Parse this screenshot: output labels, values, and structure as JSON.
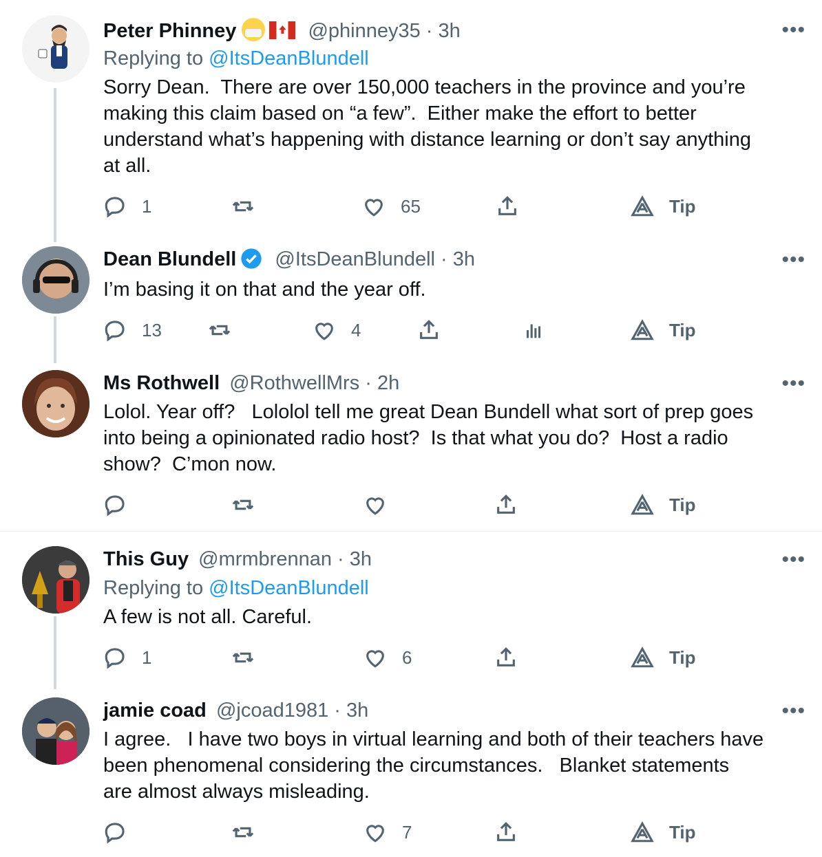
{
  "tweets": [
    {
      "name": "Peter Phinney",
      "handle": "@phinney35 · 3h",
      "replying_prefix": "Replying to ",
      "replying_to": "@ItsDeanBlundell",
      "text": "Sorry Dean.  There are over 150,000 teachers in the province and you’re\nmaking this claim based on “a few”.  Either make the effort to better\nunderstand what’s happening with distance learning or don’t say anything\nat all.",
      "replies": "1",
      "retweets": "",
      "likes": "65",
      "tip": "Tip"
    },
    {
      "name": "Dean Blundell",
      "handle": "@ItsDeanBlundell · 3h",
      "text": "I’m basing it on that and the year off.",
      "replies": "13",
      "retweets": "",
      "likes": "4",
      "tip": "Tip"
    },
    {
      "name": "Ms Rothwell",
      "handle": "@RothwellMrs · 2h",
      "text": "Lolol. Year off?   Lololol tell me great Dean Bundell what sort of prep goes\ninto being a opinionated radio host?  Is that what you do?  Host a radio\nshow?  C’mon now.",
      "replies": "",
      "retweets": "",
      "likes": "",
      "tip": "Tip"
    },
    {
      "name": "This Guy",
      "handle": "@mrmbrennan · 3h",
      "replying_prefix": "Replying to ",
      "replying_to": "@ItsDeanBlundell",
      "text": "A few is not all. Careful.",
      "replies": "1",
      "retweets": "",
      "likes": "6",
      "tip": "Tip"
    },
    {
      "name": "jamie coad",
      "handle": "@jcoad1981 · 3h",
      "text": "I agree.   I have two boys in virtual learning and both of their teachers have\nbeen phenomenal considering the circumstances.   Blanket statements\nare almost always misleading.",
      "replies": "",
      "retweets": "",
      "likes": "7",
      "tip": "Tip"
    }
  ],
  "more_label": "•••",
  "colors": {
    "accent": "#1d9bf0",
    "muted": "#536471",
    "thread_line": "#cfd9de"
  },
  "icons": [
    "reply-icon",
    "retweet-icon",
    "like-icon",
    "share-icon",
    "analytics-icon",
    "tip-icon",
    "verified-icon"
  ]
}
